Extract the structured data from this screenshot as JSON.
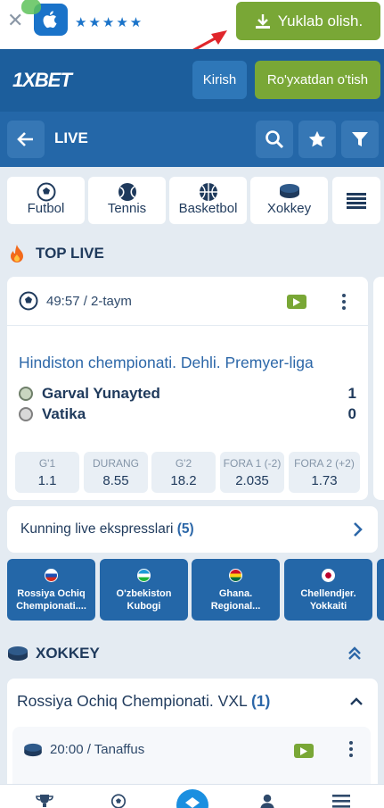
{
  "promo": {
    "stars": "★★★★★",
    "download_label": "Yuklab olish."
  },
  "header": {
    "logo": "1XBET",
    "login_label": "Kirish",
    "register_label": "Ro'yxatdan o'tish"
  },
  "livebar": {
    "title": "LIVE"
  },
  "sports": [
    {
      "label": "Futbol",
      "icon": "soccer-ball-icon"
    },
    {
      "label": "Tennis",
      "icon": "tennis-ball-icon"
    },
    {
      "label": "Basketbol",
      "icon": "basketball-icon"
    },
    {
      "label": "Xokkey",
      "icon": "hockey-puck-icon"
    }
  ],
  "top_live": {
    "title": "TOP LIVE"
  },
  "match": {
    "time": "49:57 / 2-taym",
    "league": "Hindiston chempionati. Dehli. Premyer-liga",
    "team1": "Garval Yunayted",
    "team2": "Vatika",
    "score1": "1",
    "score2": "0",
    "odds": [
      {
        "label": "G'1",
        "value": "1.1"
      },
      {
        "label": "DURANG",
        "value": "8.55"
      },
      {
        "label": "G'2",
        "value": "18.2"
      },
      {
        "label": "FORA 1 (-2)",
        "value": "2.035"
      },
      {
        "label": "FORA 2 (+2)",
        "value": "1.73"
      }
    ]
  },
  "express": {
    "label": "Kunning live ekspresslari",
    "count": "(5)"
  },
  "championships": [
    {
      "name": "Rossiya Ochiq Chempionati....",
      "flag": "russia"
    },
    {
      "name": "O'zbekiston Kubogi",
      "flag": "uzbekistan"
    },
    {
      "name": "Ghana. Regional...",
      "flag": "ghana"
    },
    {
      "name": "Chellendjer. Yokkaiti",
      "flag": "japan"
    }
  ],
  "hockey": {
    "title": "XOKKEY",
    "championship": "Rossiya Ochiq Chempionati. VXL",
    "count": "(1)",
    "time": "20:00 / Tanaffus"
  },
  "colors": {
    "brand_blue": "#1c5e9c",
    "accent_green": "#79a736",
    "link_blue": "#2c67a8"
  }
}
